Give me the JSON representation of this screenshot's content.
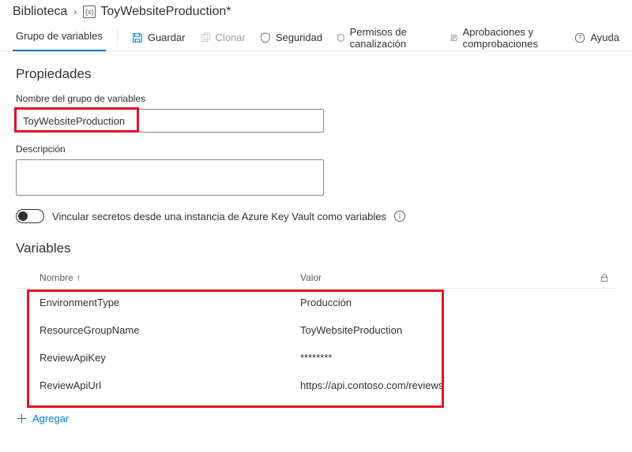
{
  "breadcrumb": {
    "root": "Biblioteca",
    "current": "ToyWebsiteProduction*"
  },
  "tab": {
    "label": "Grupo de variables"
  },
  "toolbar": {
    "save": "Guardar",
    "clone": "Clonar",
    "security": "Seguridad",
    "pipeline_permissions": "Permisos de canalización",
    "approvals": "Aprobaciones y comprobaciones",
    "help": "Ayuda"
  },
  "properties": {
    "heading": "Propiedades",
    "name_label": "Nombre del grupo de variables",
    "name_value": "ToyWebsiteProduction",
    "description_label": "Descripción",
    "description_value": "",
    "kv_toggle_label": "Vincular secretos desde una instancia de Azure Key Vault como variables"
  },
  "variables": {
    "heading": "Variables",
    "col_name": "Nombre",
    "col_value": "Valor",
    "rows": [
      {
        "name": "EnvironmentType",
        "value": "Producción"
      },
      {
        "name": "ResourceGroupName",
        "value": "ToyWebsiteProduction"
      },
      {
        "name": "ReviewApiKey",
        "value": "********"
      },
      {
        "name": "ReviewApiUrl",
        "value": "https://api.contoso.com/reviews"
      }
    ],
    "add": "Agregar"
  }
}
